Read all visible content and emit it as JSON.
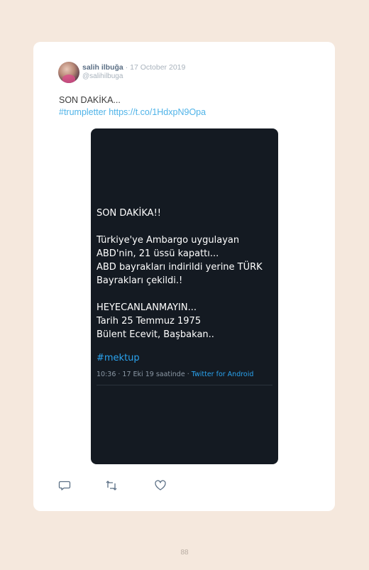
{
  "tweet": {
    "display_name": "salih ilbuğa",
    "separator": "·",
    "date": "17 October 2019",
    "handle": "@salihilbuga",
    "text_line1": "SON DAKİKA...",
    "hashtag": "#trumpletter",
    "url": "https://t.co/1HdxpN9Opa"
  },
  "embedded_tweet": {
    "lines": [
      "SON DAKİKA!!",
      "",
      "Türkiye'ye Ambargo uygulayan",
      "ABD'nin, 21 üssü kapattı...",
      "ABD bayrakları indirildi yerine TÜRK",
      "Bayrakları çekildi.!",
      "",
      "HEYECANLANMAYIN...",
      "Tarih 25 Temmuz 1975",
      "Bülent Ecevit, Başbakan.."
    ],
    "hashtag": "#mektup",
    "meta_time": "10:36 · 17 Eki 19 saatinde · ",
    "meta_app": "Twitter for Android"
  },
  "actions": {
    "reply_icon": "reply-icon",
    "retweet_icon": "retweet-icon",
    "like_icon": "heart-icon"
  },
  "colors": {
    "page_bg": "#f5e8dd",
    "card_bg": "#ffffff",
    "embed_bg": "#141a22",
    "link": "#4fb3e8",
    "embed_link": "#2aa3ef"
  },
  "page_number": "88"
}
